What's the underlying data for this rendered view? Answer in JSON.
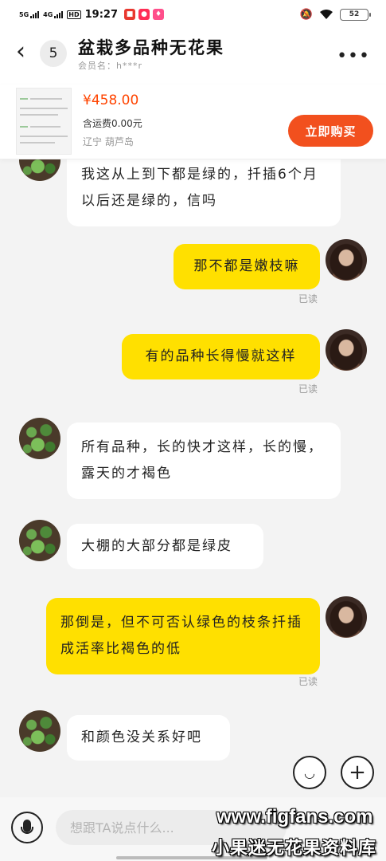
{
  "status": {
    "net1": "5G",
    "net2": "4G",
    "hd": "HD",
    "time": "19:27",
    "battery": "52"
  },
  "header": {
    "unread_count": "5",
    "title": "盆栽多品种无花果",
    "member": "会员名：h***r"
  },
  "product": {
    "price": "¥458.00",
    "shipping": "含运费0.00元",
    "location": "辽宁 葫芦岛",
    "buy_label": "立即购买"
  },
  "messages": [
    {
      "side": "left",
      "text": "我这从上到下都是绿的，扦插6个月以后还是绿的，信吗",
      "avatar": "plant"
    },
    {
      "side": "right",
      "text": "那不都是嫩枝嘛",
      "read": "已读",
      "avatar": "girl"
    },
    {
      "side": "right",
      "text": "有的品种长得慢就这样",
      "read": "已读",
      "avatar": "girl"
    },
    {
      "side": "left",
      "text": "所有品种，长的快才这样，长的慢，露天的才褐色",
      "avatar": "plant"
    },
    {
      "side": "left",
      "text": "大棚的大部分都是绿皮",
      "avatar": "plant"
    },
    {
      "side": "right",
      "text": "那倒是，但不可否认绿色的枝条扦插成活率比褐色的低",
      "read": "已读",
      "avatar": "girl"
    },
    {
      "side": "left",
      "text": "和颜色没关系好吧",
      "avatar": "plant"
    }
  ],
  "input": {
    "placeholder": "想跟TA说点什么..."
  },
  "watermark": {
    "line1": "www.figfans.com",
    "line2": "小果迷无花果资料库"
  }
}
